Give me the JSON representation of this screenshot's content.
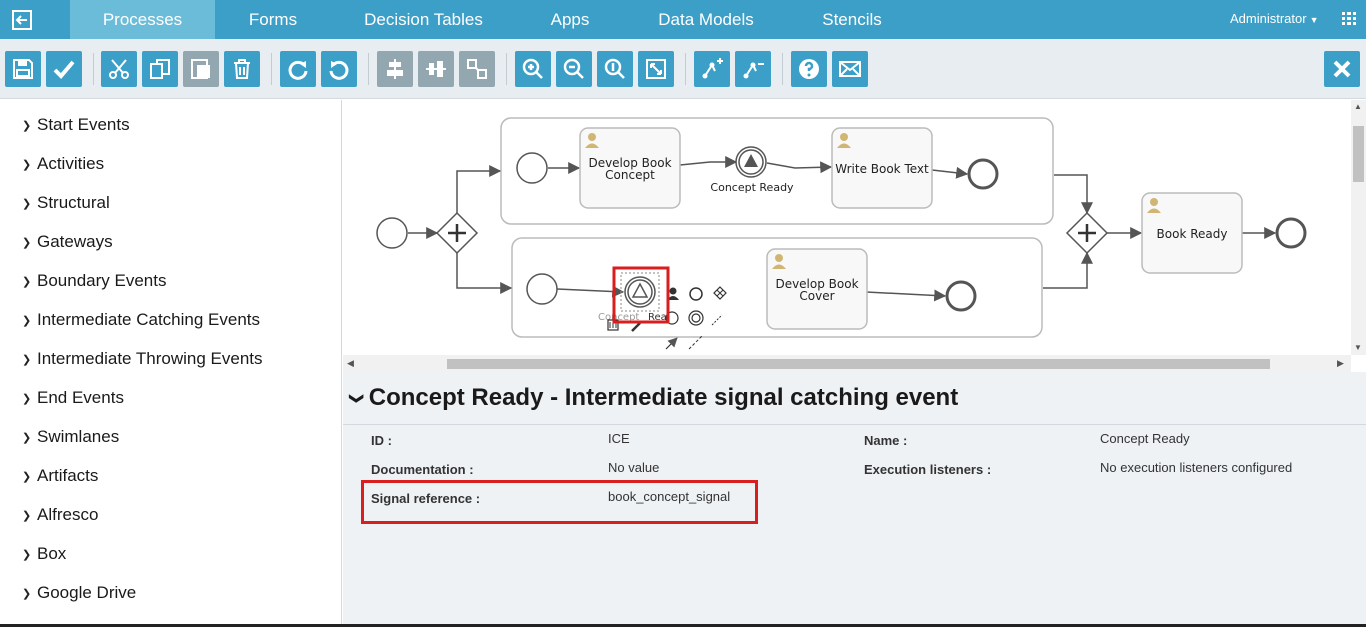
{
  "nav": {
    "tabs": [
      "Processes",
      "Forms",
      "Decision Tables",
      "Apps",
      "Data Models",
      "Stencils"
    ],
    "active_tab": "Processes",
    "user": "Administrator"
  },
  "toolbar": {
    "buttons": [
      "save",
      "validate",
      "cut",
      "copy",
      "paste",
      "delete",
      "redo",
      "undo",
      "align-horizontal",
      "align-vertical",
      "same-size",
      "zoom-in",
      "zoom-out",
      "zoom-actual",
      "zoom-fit",
      "bendpoint-add",
      "bendpoint-remove",
      "help",
      "feedback",
      "close"
    ]
  },
  "palette": {
    "items": [
      "Start Events",
      "Activities",
      "Structural",
      "Gateways",
      "Boundary Events",
      "Intermediate Catching Events",
      "Intermediate Throwing Events",
      "End Events",
      "Swimlanes",
      "Artifacts",
      "Alfresco",
      "Box",
      "Google Drive"
    ]
  },
  "diagram": {
    "tasks": {
      "develop_concept": [
        "Develop Book",
        "Concept"
      ],
      "write_text": "Write Book Text",
      "develop_cover": [
        "Develop Book",
        "Cover"
      ],
      "book_ready": "Book Ready"
    },
    "event_label": "Concept Ready",
    "selected_label_fragment_a": "Concept",
    "selected_label_fragment_b": "Rea"
  },
  "properties": {
    "title": "Concept Ready - Intermediate signal catching event",
    "id_label": "ID :",
    "id_value": "ICE",
    "name_label": "Name :",
    "name_value": "Concept Ready",
    "doc_label": "Documentation :",
    "doc_value": "No value",
    "exec_label": "Execution listeners :",
    "exec_value": "No execution listeners configured",
    "signal_label": "Signal reference :",
    "signal_value": "book_concept_signal"
  },
  "colors": {
    "nav": "#3b9fc7",
    "nav_active": "#6bbcd9",
    "highlight": "#d81e1e",
    "task_fill": "#f8f8f8",
    "user_icon": "#d1b574"
  }
}
